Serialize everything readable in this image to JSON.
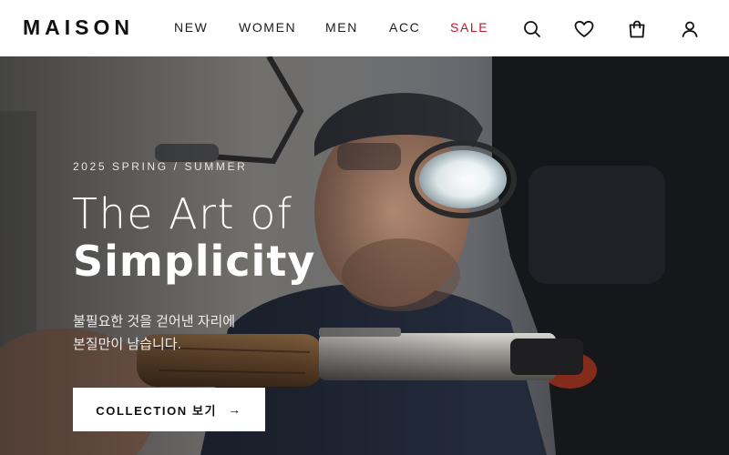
{
  "header": {
    "logo": "MAISON",
    "nav": [
      {
        "label": "NEW"
      },
      {
        "label": "WOMEN"
      },
      {
        "label": "MEN"
      },
      {
        "label": "ACC"
      },
      {
        "label": "SALE"
      }
    ],
    "icons": [
      "search-icon",
      "heart-icon",
      "bag-icon",
      "user-icon"
    ],
    "sale_color": "#c0182e"
  },
  "hero": {
    "eyebrow": "2025 SPRING / SUMMER",
    "title_line1": "The Art of",
    "title_line2": "Simplicity",
    "description_line1": "불필요한 것을 걷어낸 자리에",
    "description_line2": "본질만이 남습니다.",
    "cta_label": "COLLECTION 보기",
    "cta_arrow": "→"
  }
}
